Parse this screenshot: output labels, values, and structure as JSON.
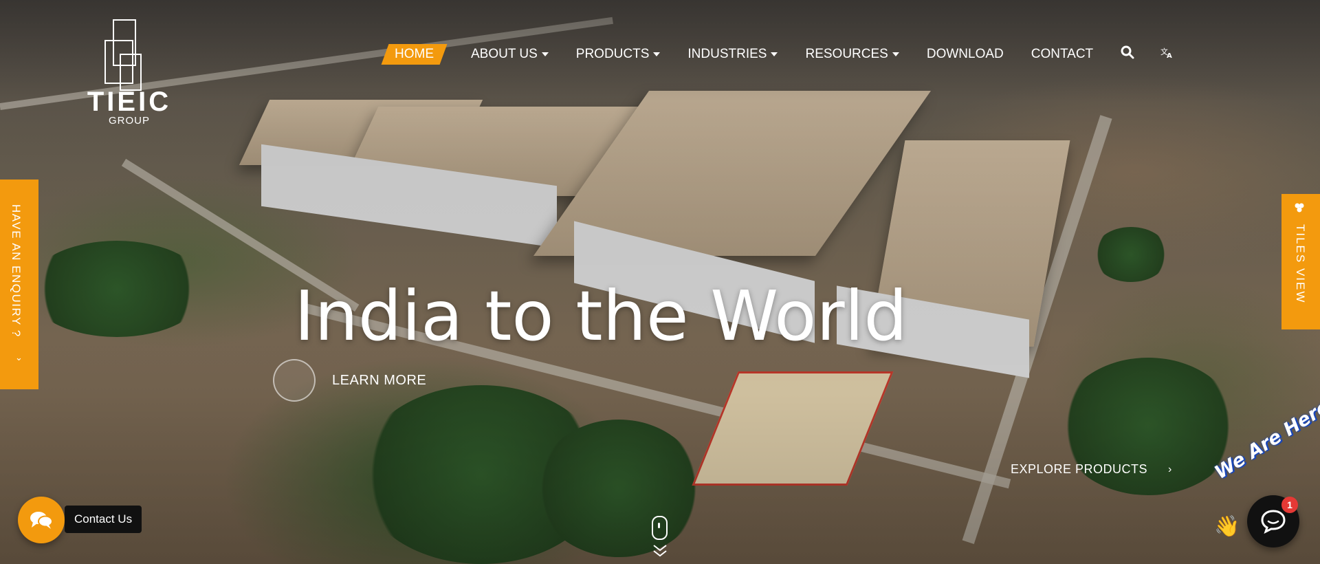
{
  "brand": {
    "name": "TIEIC",
    "sub": "GROUP"
  },
  "nav": {
    "items": [
      {
        "label": "HOME",
        "active": true,
        "dropdown": false
      },
      {
        "label": "ABOUT US",
        "active": false,
        "dropdown": true
      },
      {
        "label": "PRODUCTS",
        "active": false,
        "dropdown": true
      },
      {
        "label": "INDUSTRIES",
        "active": false,
        "dropdown": true
      },
      {
        "label": "RESOURCES",
        "active": false,
        "dropdown": true
      },
      {
        "label": "DOWNLOAD",
        "active": false,
        "dropdown": false
      },
      {
        "label": "CONTACT",
        "active": false,
        "dropdown": false
      }
    ],
    "search_icon": "search-icon",
    "language_icon": "translate-icon"
  },
  "hero": {
    "title": "India to the World",
    "learn_more": "LEARN MORE",
    "explore": "EXPLORE PRODUCTS",
    "explore_arrow": "›"
  },
  "side": {
    "enquiry": "HAVE AN ENQUIRY ?",
    "enquiry_chevron": "⌄",
    "tiles": "TILES VIEW"
  },
  "scroll": {
    "count": "0"
  },
  "contact": {
    "label": "Contact Us"
  },
  "chat": {
    "tagline": "We Are Here!",
    "badge": "1"
  },
  "colors": {
    "accent": "#f39a0e",
    "badge": "#e53935"
  }
}
